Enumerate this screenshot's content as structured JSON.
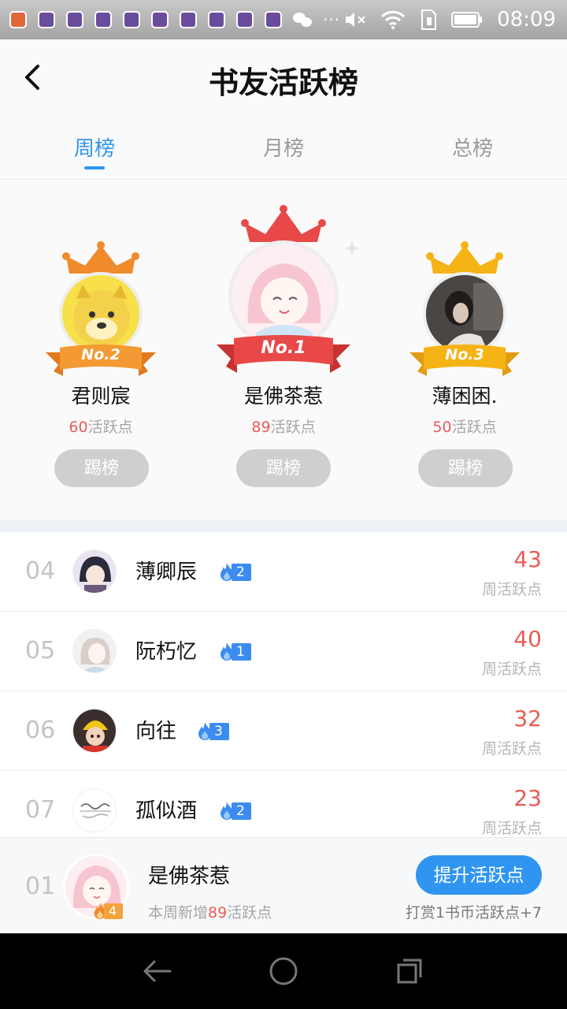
{
  "status_bar": {
    "time": "08:09",
    "icons": [
      "notification-icon",
      "app-icon",
      "wechat-icon",
      "more-dots-icon",
      "mute-icon",
      "wifi-icon",
      "sim-icon",
      "battery-icon"
    ]
  },
  "header": {
    "title": "书友活跃榜"
  },
  "tabs": [
    {
      "label": "周榜",
      "active": true
    },
    {
      "label": "月榜",
      "active": false
    },
    {
      "label": "总榜",
      "active": false
    }
  ],
  "podium": [
    {
      "place": "No.1",
      "name": "是佛茶惹",
      "points": "89",
      "points_suffix": "活跃点",
      "button": "踢榜"
    },
    {
      "place": "No.2",
      "name": "君则宸",
      "points": "60",
      "points_suffix": "活跃点",
      "button": "踢榜"
    },
    {
      "place": "No.3",
      "name": "薄困困.",
      "points": "50",
      "points_suffix": "活跃点",
      "button": "踢榜"
    }
  ],
  "list": [
    {
      "rank": "04",
      "name": "薄卿辰",
      "level": "2",
      "score": "43",
      "score_label": "周活跃点"
    },
    {
      "rank": "05",
      "name": "阮朽忆",
      "level": "1",
      "score": "40",
      "score_label": "周活跃点"
    },
    {
      "rank": "06",
      "name": "向往",
      "level": "3",
      "score": "32",
      "score_label": "周活跃点"
    },
    {
      "rank": "07",
      "name": "孤似酒",
      "level": "2",
      "score": "23",
      "score_label": "周活跃点"
    }
  ],
  "me": {
    "rank": "01",
    "name": "是佛茶惹",
    "level": "4",
    "sub_prefix": "本周新增",
    "sub_points": "89",
    "sub_suffix": "活跃点",
    "button": "提升活跃点",
    "hint": "打赏1书币活跃点+7"
  },
  "colors": {
    "accent": "#2f95f0",
    "points_red": "#ea5b55",
    "gold": "#f6b315",
    "orange": "#f08a2a",
    "red": "#e84848"
  }
}
